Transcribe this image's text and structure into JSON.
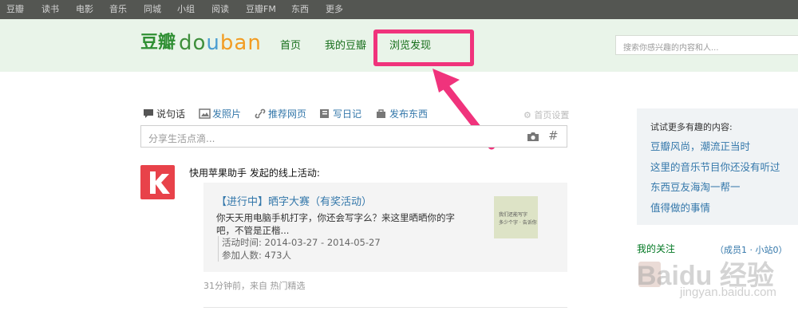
{
  "topbar": {
    "items": [
      "豆瓣",
      "读书",
      "电影",
      "音乐",
      "同城",
      "小组",
      "阅读",
      "豆瓣FM",
      "东西",
      "更多"
    ]
  },
  "header": {
    "logo_cn": "豆瓣",
    "logo_en": [
      "do",
      "u",
      "ban"
    ],
    "nav": [
      "首页",
      "我的豆瓣",
      "浏览发现"
    ],
    "search_placeholder": "搜索你感兴趣的内容和人...",
    "highlight_color": "#f0337c"
  },
  "status_bar": {
    "tools": [
      "说句话",
      "发照片",
      "推荐网页",
      "写日记",
      "发布东西"
    ],
    "settings": "首页设置",
    "input_placeholder": "分享生活点滴...",
    "hash": "#"
  },
  "feed": {
    "avatar_letter": "k",
    "actor_text": "快用苹果助手 发起的线上活动:",
    "card": {
      "title": "【进行中】晒字大赛（有奖活动）",
      "desc": "你天天用电脑手机打字，你还会写字么？来这里晒晒你的字吧，不管是正楷...",
      "time": "活动时间: 2014-03-27 - 2014-05-27",
      "participants": "参加人数: 473人",
      "thumb_text": [
        "我们还能写字",
        "多少个字 · 告诉你"
      ]
    },
    "meta": "31分钟前，来自 热门精选"
  },
  "sidebar": {
    "head": "试试更多有趣的内容:",
    "links": [
      "豆瓣风尚，潮流正当时",
      "这里的音乐节目你还没有听过",
      "东西豆友海淘一帮一",
      "值得做的事情"
    ],
    "follow_title": "我的关注",
    "follow_count": "（成员1 · 小站0）"
  },
  "watermark": {
    "main": "Baidu 经验",
    "sub": "jingyan.baidu.com"
  },
  "colors": {
    "topbar": "#545652",
    "header_bg": "#e9f4e9",
    "link": "#3377aa",
    "nav_green": "#166e1a"
  }
}
